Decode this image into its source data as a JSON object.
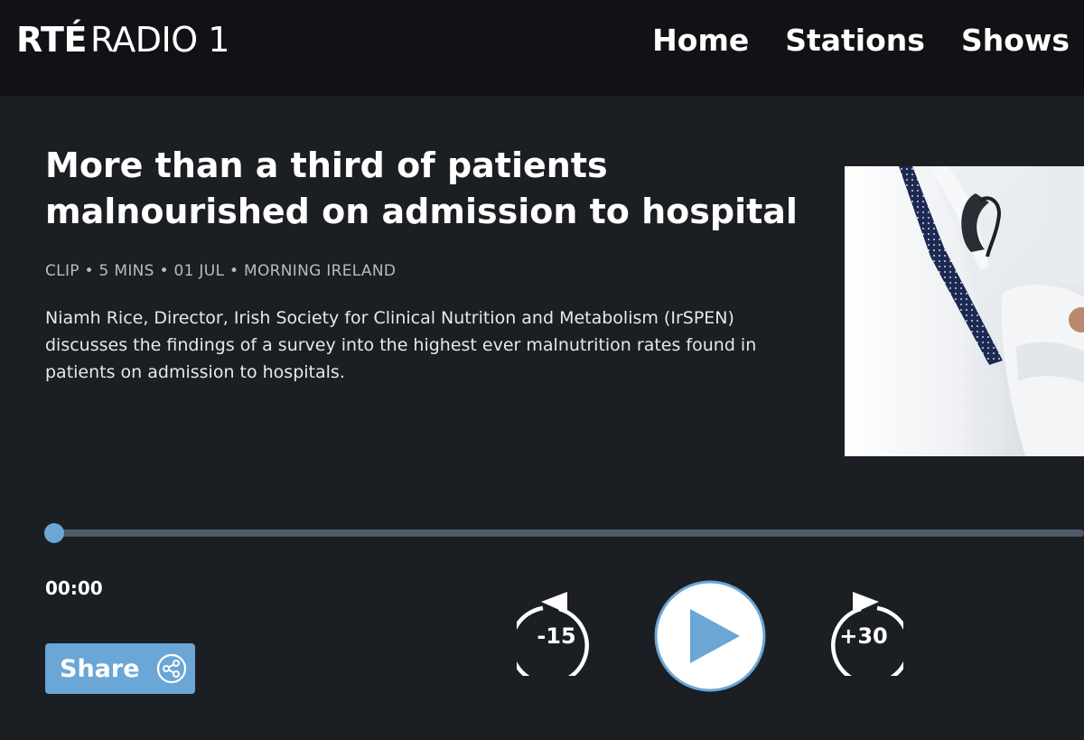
{
  "header": {
    "logo_brand": "RTÉ",
    "logo_station": "RADIO 1",
    "nav": [
      "Home",
      "Stations",
      "Shows"
    ]
  },
  "clip": {
    "title": "More than a third of patients malnourished on admission to hospital",
    "meta": "CLIP • 5 MINS • 01 JUL • MORNING IRELAND",
    "description": "Niamh Rice, Director, Irish Society for Clinical Nutrition and Metabolism (IrSPEN) discusses the findings of a survey into the highest ever malnutrition rates found in patients on admission to hospitals.",
    "image_alt": "Doctor in white coat with stethoscope"
  },
  "player": {
    "current_time": "00:00",
    "progress": 0,
    "rewind_label": "-15",
    "forward_label": "+30",
    "play_icon": "play-icon"
  },
  "share": {
    "label": "Share",
    "icon": "share-icon"
  },
  "colors": {
    "background": "#1b1e22",
    "header": "#101215",
    "accent": "#6aa6d6",
    "track": "#4e5a68",
    "meta_text": "#b8bcc2"
  }
}
